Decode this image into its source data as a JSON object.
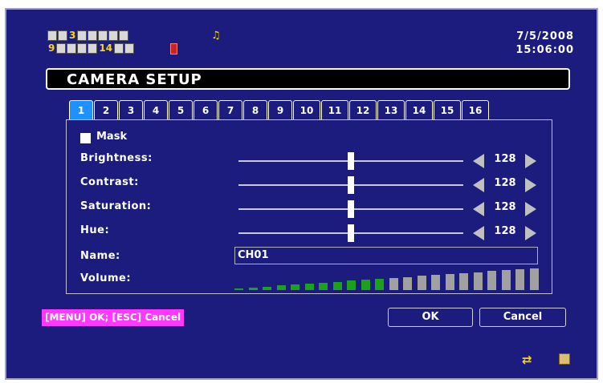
{
  "status": {
    "row1": [
      {
        "type": "box"
      },
      {
        "type": "box"
      },
      {
        "type": "num",
        "text": "3"
      },
      {
        "type": "box"
      },
      {
        "type": "box"
      },
      {
        "type": "box"
      },
      {
        "type": "box"
      },
      {
        "type": "box"
      }
    ],
    "row2": [
      {
        "type": "num",
        "text": "9"
      },
      {
        "type": "box"
      },
      {
        "type": "box"
      },
      {
        "type": "box"
      },
      {
        "type": "box"
      },
      {
        "type": "num",
        "text": "14"
      },
      {
        "type": "box"
      },
      {
        "type": "box"
      }
    ],
    "date": "7/5/2008",
    "time": "15:06:00",
    "rec_color": "#d02020"
  },
  "title": "CAMERA SETUP",
  "tabs": [
    "1",
    "2",
    "3",
    "4",
    "5",
    "6",
    "7",
    "8",
    "9",
    "10",
    "11",
    "12",
    "13",
    "14",
    "15",
    "16"
  ],
  "active_tab": "1",
  "mask": {
    "label": "Mask",
    "checked": false
  },
  "sliders": [
    {
      "label": "Brightness:",
      "value": "128"
    },
    {
      "label": "Contrast:",
      "value": "128"
    },
    {
      "label": "Saturation:",
      "value": "128"
    },
    {
      "label": "Hue:",
      "value": "128"
    }
  ],
  "name": {
    "label": "Name:",
    "value": "CH01"
  },
  "volume": {
    "label": "Volume:",
    "level": 11,
    "total": 22
  },
  "hint": "[MENU] OK; [ESC] Cancel",
  "buttons": {
    "ok": "OK",
    "cancel": "Cancel"
  },
  "colors": {
    "background": "#1b1c7d",
    "active_tab": "#1e90ff",
    "hint_bg": "#ff38ff",
    "volume_on": "#1aa31a",
    "volume_off": "#a0a0a0"
  }
}
